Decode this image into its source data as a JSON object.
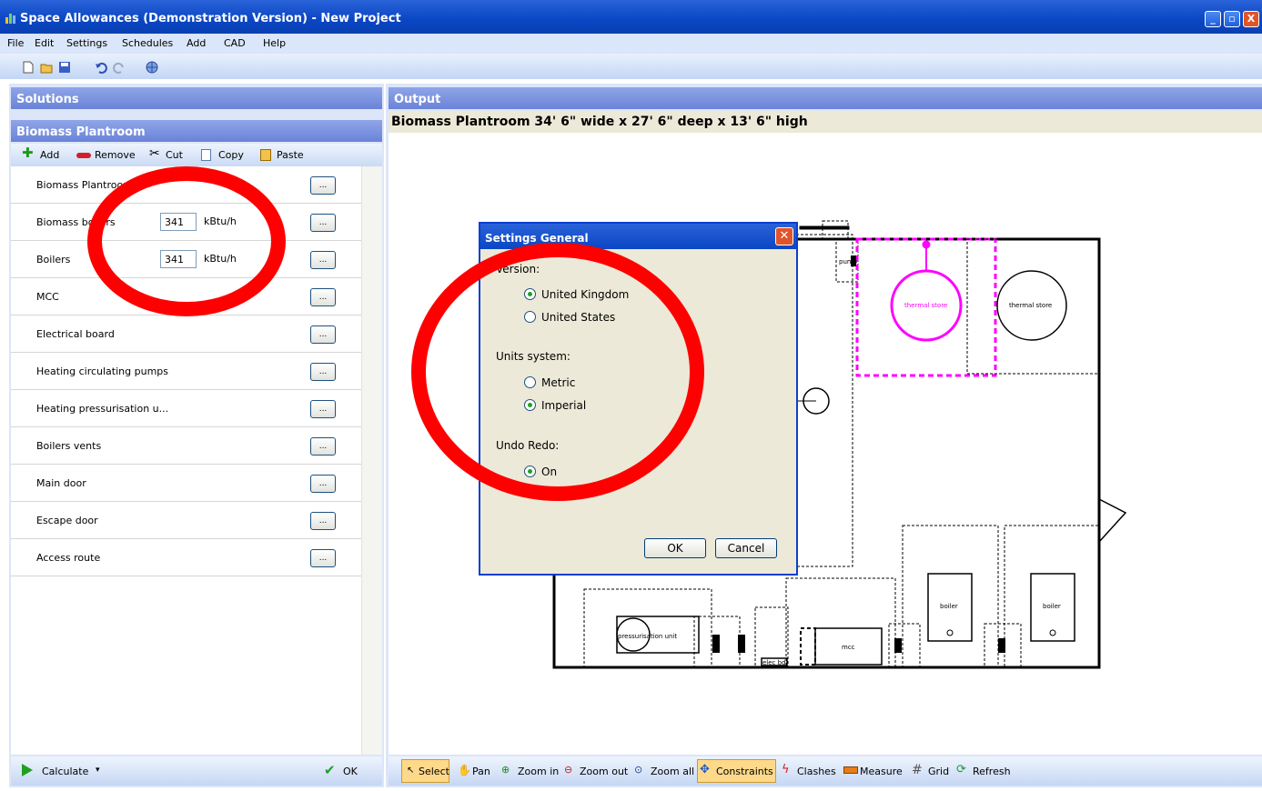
{
  "window": {
    "title": "Space Allowances (Demonstration Version) - New Project",
    "buttons": [
      "_",
      "▫",
      "X"
    ]
  },
  "menu": [
    "File",
    "Edit",
    "Settings",
    "Schedules",
    "Add",
    "CAD",
    "Help"
  ],
  "toolbar_icons": [
    "new-icon",
    "open-icon",
    "save-icon",
    "undo-icon",
    "redo-icon",
    "web-icon"
  ],
  "solutions_panel": {
    "title": "Solutions",
    "sub_title": "Biomass Plantroom"
  },
  "list_toolbar": {
    "add": "Add",
    "remove": "Remove",
    "cut": "Cut",
    "copy": "Copy",
    "paste": "Paste"
  },
  "list": [
    {
      "label": "Biomass Plantroom",
      "value": "",
      "unit": "",
      "button": "..."
    },
    {
      "label": "Biomass boilers",
      "value": "341",
      "unit": "kBtu/h",
      "button": "..."
    },
    {
      "label": "Boilers",
      "value": "341",
      "unit": "kBtu/h",
      "button": "..."
    },
    {
      "label": "MCC",
      "value": "",
      "unit": "",
      "button": "..."
    },
    {
      "label": "Electrical board",
      "value": "",
      "unit": "",
      "button": "..."
    },
    {
      "label": "Heating circulating pumps",
      "value": "",
      "unit": "",
      "button": "..."
    },
    {
      "label": "Heating pressurisation u...",
      "value": "",
      "unit": "",
      "button": "..."
    },
    {
      "label": "Boilers vents",
      "value": "",
      "unit": "",
      "button": "..."
    },
    {
      "label": "Main door",
      "value": "",
      "unit": "",
      "button": "..."
    },
    {
      "label": "Escape door",
      "value": "",
      "unit": "",
      "button": "..."
    },
    {
      "label": "Access route",
      "value": "",
      "unit": "",
      "button": "..."
    }
  ],
  "left_bottom": {
    "calculate": "Calculate",
    "ok": "OK"
  },
  "output": {
    "title": "Output",
    "heading": "Biomass Plantroom 34' 6\" wide x 27' 6\" deep x 13' 6\" high"
  },
  "drawing": {
    "thermal_store_1": "thermal store",
    "thermal_store_2": "thermal store",
    "boiler_1": "boiler",
    "boiler_2": "boiler",
    "mcc": "mcc",
    "pressurisation": "pressurisation unit",
    "pump": "pump",
    "elec": "elec bd"
  },
  "output_toolbar": {
    "select": "Select",
    "pan": "Pan",
    "zoom_in": "Zoom in",
    "zoom_out": "Zoom out",
    "zoom_all": "Zoom all",
    "constraints": "Constraints",
    "clashes": "Clashes",
    "measure": "Measure",
    "grid": "Grid",
    "refresh": "Refresh"
  },
  "dialog": {
    "title": "Settings General",
    "version_label": "Version:",
    "version_options": [
      "United Kingdom",
      "United States"
    ],
    "version_selected": "United Kingdom",
    "units_label": "Units system:",
    "units_options": [
      "Metric",
      "Imperial"
    ],
    "units_selected": "Imperial",
    "undo_label": "Undo Redo:",
    "undo_options": [
      "On"
    ],
    "undo_selected": "On",
    "ok": "OK",
    "cancel": "Cancel"
  },
  "colors": {
    "title_bar": "#0a46c4",
    "panel_header": "#7b93e0",
    "annotation": "#ff0000",
    "thermal_store_selected": "#ff00ff"
  }
}
